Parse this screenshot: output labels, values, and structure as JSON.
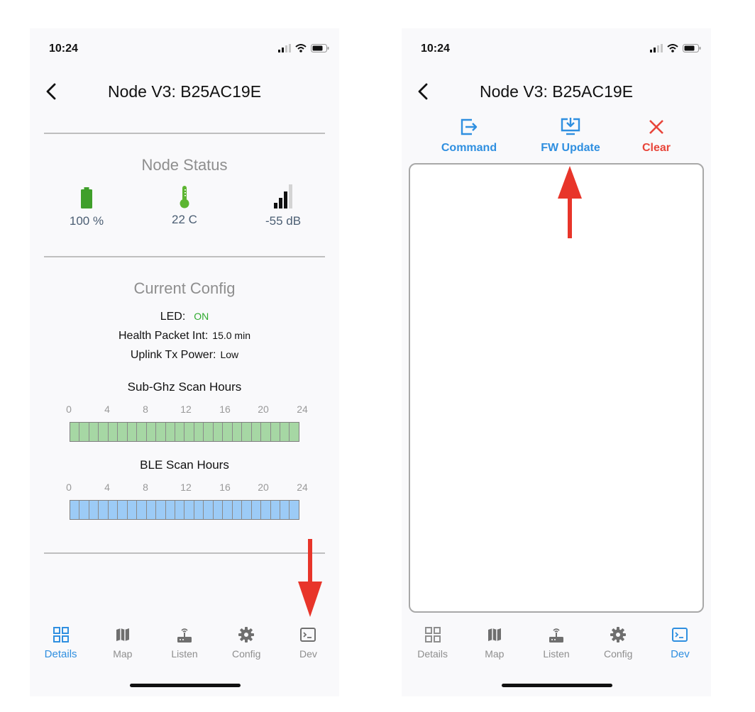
{
  "left": {
    "status": {
      "time": "10:24"
    },
    "header": {
      "title": "Node V3: B25AC19E"
    },
    "node_status": {
      "title": "Node Status",
      "battery": "100 %",
      "temperature": "22 C",
      "signal": "-55 dB"
    },
    "current_config": {
      "title": "Current Config",
      "led_label": "LED:",
      "led_value": "ON",
      "health_label": "Health Packet Int:",
      "health_value": "15.0 min",
      "uplink_label": "Uplink Tx Power:",
      "uplink_value": "Low"
    },
    "subghz": {
      "title": "Sub-Ghz Scan Hours",
      "ticks": [
        "0",
        "4",
        "8",
        "12",
        "16",
        "20",
        "24"
      ],
      "active_hours": 24
    },
    "ble": {
      "title": "BLE Scan Hours",
      "ticks": [
        "0",
        "4",
        "8",
        "12",
        "16",
        "20",
        "24"
      ],
      "active_hours": 24
    },
    "tabs": [
      "Details",
      "Map",
      "Listen",
      "Config",
      "Dev"
    ],
    "active_tab": "Details"
  },
  "right": {
    "status": {
      "time": "10:24"
    },
    "header": {
      "title": "Node V3: B25AC19E"
    },
    "toolbar": {
      "command": "Command",
      "fw_update": "FW Update",
      "clear": "Clear"
    },
    "console_text": "",
    "tabs": [
      "Details",
      "Map",
      "Listen",
      "Config",
      "Dev"
    ],
    "active_tab": "Dev"
  },
  "colors": {
    "accent_blue": "#2f8fe0",
    "clear_red": "#e8453a",
    "led_on_green": "#2eaa2e",
    "battery_green": "#3f9f2a",
    "thermometer_green": "#5cb531",
    "subghz_fill": "#a6d7a4",
    "ble_fill": "#9ccbf6",
    "annotation_arrow": "#e8352a"
  },
  "icons": {
    "tab_icons": [
      "grid-icon",
      "map-icon",
      "router-icon",
      "gear-icon",
      "terminal-icon"
    ],
    "stat_icons": [
      "battery-icon",
      "thermometer-icon",
      "signal-bars-icon"
    ],
    "toolbar_icons": [
      "send-command-icon",
      "download-monitor-icon",
      "close-x-icon"
    ]
  }
}
